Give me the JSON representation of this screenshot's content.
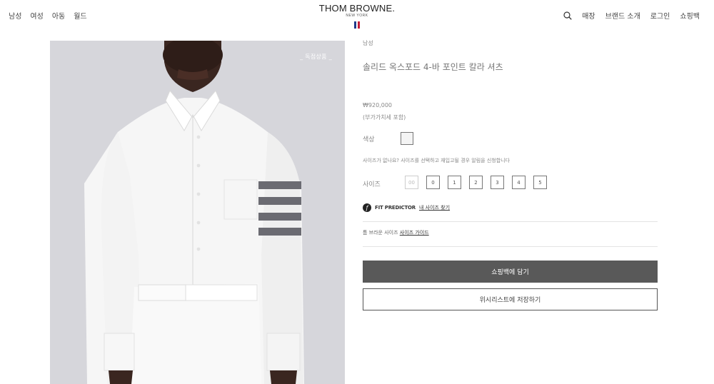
{
  "header": {
    "nav_left": [
      "남성",
      "여성",
      "아동",
      "월드"
    ],
    "logo": {
      "main": "THOM BROWNE.",
      "sub": "NEW YORK",
      "flag_colors": [
        "#1f3a8a",
        "#ffffff",
        "#c41e3a"
      ]
    },
    "nav_right": [
      "매장",
      "브랜드 소개",
      "로그인",
      "쇼핑백"
    ],
    "search_icon": "search-icon"
  },
  "product_image": {
    "tag": "_ 독점상품 _",
    "background": "#d6d6db",
    "stripe_color": "#6b6b72"
  },
  "product": {
    "category": "남성",
    "title": "솔리드 옥스포드 4-바 포인트 칼라 셔츠",
    "price": "₩920,000",
    "vat_note": "(부가가치세 포함)",
    "color_label": "색상",
    "size_notice": "사이즈가 없나요? 사이즈를 선택하고 재입고될 경우 알림을 신청합니다",
    "size_label": "사이즈",
    "sizes": [
      {
        "label": "00",
        "disabled": true
      },
      {
        "label": "0",
        "disabled": false
      },
      {
        "label": "1",
        "disabled": false
      },
      {
        "label": "2",
        "disabled": false
      },
      {
        "label": "3",
        "disabled": false
      },
      {
        "label": "4",
        "disabled": false
      },
      {
        "label": "5",
        "disabled": false
      }
    ],
    "fit_predictor": {
      "name": "FIT PREDICTOR",
      "link": "내 사이즈 찾기",
      "icon": "fit-predictor-icon"
    },
    "size_guide": {
      "prefix": "톰 브라운 사이즈",
      "link": "사이즈 가이드"
    },
    "add_to_bag": "쇼핑백에 담기",
    "wishlist": "위시리스트에 저장하기"
  },
  "colors": {
    "button_dark": "#595959",
    "border": "#555555"
  }
}
